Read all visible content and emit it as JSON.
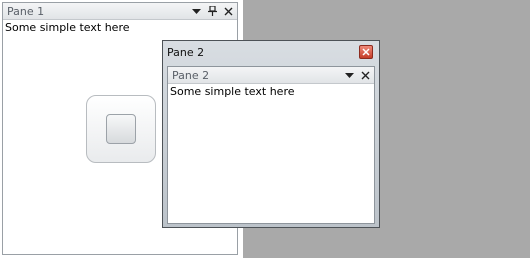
{
  "pane1": {
    "title": "Pane 1",
    "content": "Some simple text here",
    "menu_icon": "chevron-down-icon",
    "pin_icon": "pin-icon",
    "close_icon": "close-icon"
  },
  "float_window": {
    "title": "Pane 2",
    "close_icon": "close-icon"
  },
  "pane2": {
    "title": "Pane 2",
    "content": "Some simple text here",
    "menu_icon": "chevron-down-icon",
    "close_icon": "close-icon"
  },
  "colors": {
    "background_gray": "#a9a9a9",
    "float_close_red": "#c43c28"
  }
}
